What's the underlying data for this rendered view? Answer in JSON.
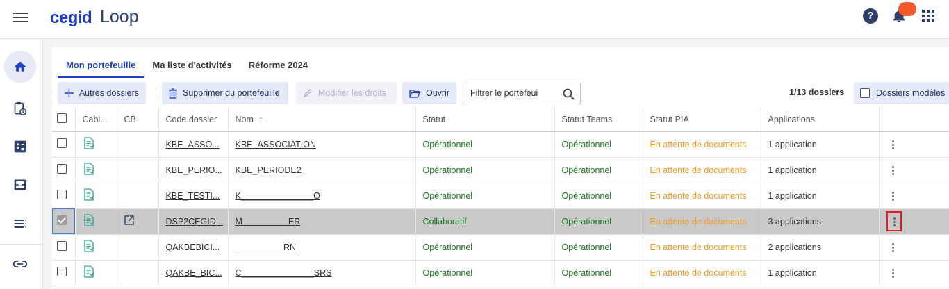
{
  "header": {
    "brand": "cegid",
    "product": "Loop",
    "help_glyph": "?"
  },
  "rail": {
    "items": [
      {
        "icon": "home-icon",
        "active": true
      },
      {
        "icon": "clipboard-clock-icon"
      },
      {
        "icon": "calculator-icon"
      },
      {
        "icon": "inbox-icon"
      },
      {
        "icon": "list-icon"
      },
      {
        "icon": "link-icon"
      }
    ]
  },
  "tabs": [
    {
      "label": "Mon portefeuille",
      "active": true
    },
    {
      "label": "Ma liste d'activités"
    },
    {
      "label": "Réforme 2024"
    }
  ],
  "toolbar": {
    "other_folders": "Autres dossiers",
    "remove": "Supprimer du portefeuille",
    "edit_rights": "Modifier les droits",
    "open": "Ouvrir",
    "filter_placeholder": "Filtrer le portefeui",
    "count": "1/13 dossiers",
    "templates": "Dossiers modèles"
  },
  "table": {
    "columns": [
      "Cabi...",
      "CB",
      "Code dossier",
      "Nom",
      "Statut",
      "Statut Teams",
      "Statut PIA",
      "Applications"
    ],
    "sort_indicator": "↑",
    "rows": [
      {
        "code": "KBE_ASSO...",
        "name": "KBE_ASSOCIATION",
        "statut": "Opérationnel",
        "teams": "Opérationnel",
        "pia": "En attente de documents",
        "apps": "1 application",
        "selected": false,
        "cb_link": false
      },
      {
        "code": "KBE_PERIO...",
        "name": "KBE_PERIODE2",
        "statut": "Opérationnel",
        "teams": "Opérationnel",
        "pia": "En attente de documents",
        "apps": "1 application",
        "selected": false,
        "cb_link": false
      },
      {
        "code": "KBE_TESTI...",
        "name": "K_______________O",
        "statut": "Opérationnel",
        "teams": "Opérationnel",
        "pia": "En attente de documents",
        "apps": "1 application",
        "selected": false,
        "cb_link": false
      },
      {
        "code": "DSP2CEGID...",
        "name": "M                   ER",
        "statut": "Collaboratif",
        "teams": "Opérationnel",
        "pia": "En attente de documents",
        "apps": "3 applications",
        "selected": true,
        "cb_link": true
      },
      {
        "code": "QAKBEBICI...",
        "name": "                    RN",
        "statut": "Opérationnel",
        "teams": "Opérationnel",
        "pia": "En attente de documents",
        "apps": "2 applications",
        "selected": false,
        "cb_link": false
      },
      {
        "code": "QAKBE_BIC...",
        "name": "C_______________SRS",
        "statut": "Opérationnel",
        "teams": "Opérationnel",
        "pia": "En attente de documents",
        "apps": "1 application",
        "selected": false,
        "cb_link": false
      }
    ]
  }
}
